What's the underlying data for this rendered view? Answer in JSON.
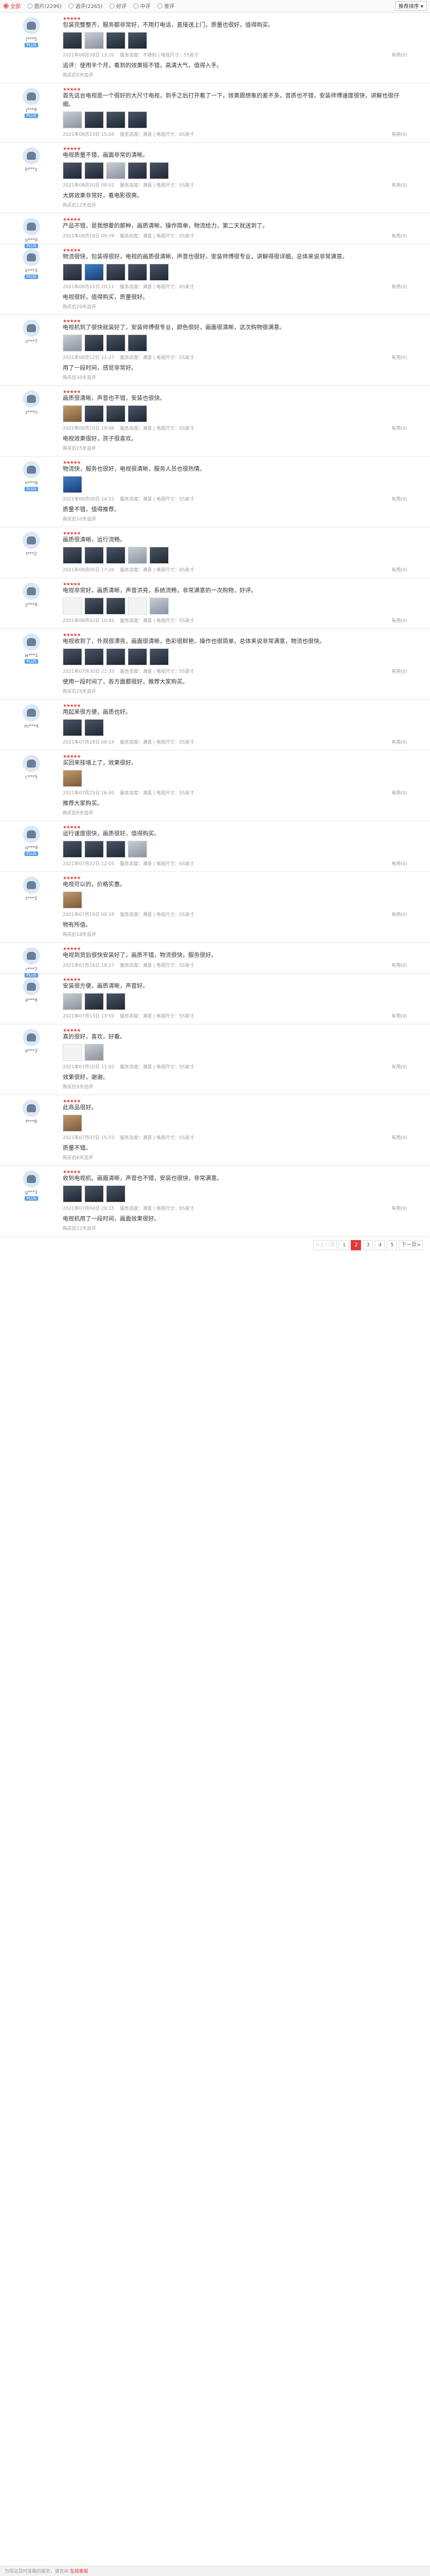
{
  "filter": {
    "options": [
      {
        "label": "全部",
        "on": true
      },
      {
        "label": "图片(2296)",
        "on": false
      },
      {
        "label": "追评(2265)",
        "on": false
      },
      {
        "label": "好评",
        "on": false
      },
      {
        "label": "中评",
        "on": false
      },
      {
        "label": "差评",
        "on": false
      }
    ],
    "sort": "推荐排序 ▾"
  },
  "reviews": [
    {
      "user": "j***5",
      "badge": "PLUS",
      "stars": "★★★★★",
      "text": "包装完整整齐，服务都非常好，不用打电话，直接送上门，质量也很好，值得购买。",
      "photos": [
        "",
        "light",
        "",
        ""
      ],
      "time": "2021年08月28日 13:20",
      "meta": "服务态度：不错的 | 电视尺寸：55英寸",
      "like": "有用(0)",
      "append": "追评：使用半个月，看到的效果挺不错，高清大气，值得入手。",
      "append_time": "购买后5天追评"
    },
    {
      "user": "j***9",
      "badge": "PLUS",
      "stars": "★★★★★",
      "text": "首先这台电视是一个很好的大尺寸电视，到手之后打开看了一下，效果跟想象的差不多，音质也不错，安装师傅速度很快，讲解也很仔细。",
      "photos": [
        "light",
        "",
        "",
        ""
      ],
      "time": "2021年08月23日 15:04",
      "meta": "服务态度：满意 | 电视尺寸：65英寸",
      "like": "有用(0)",
      "append": "",
      "append_time": ""
    },
    {
      "user": "b***y",
      "badge": "",
      "stars": "★★★★★",
      "text": "电视质量不错，画面非常的清晰。",
      "photos": [
        "",
        "",
        "light",
        "",
        ""
      ],
      "time": "2021年08月20日 08:01",
      "meta": "服务态度：满意 | 电视尺寸：55英寸",
      "like": "有用(0)",
      "append": "大屏效果非常好，看电影很爽。",
      "append_time": "购买后12天追评"
    },
    {
      "user": "p***0",
      "badge": "PLUS",
      "stars": "★★★★★",
      "text": "产品不错，是我想要的那种，画质清晰，操作简单，物流给力，第二天就送到了。",
      "photos": [],
      "time": "2021年08月18日 09:39",
      "meta": "服务态度：满意 | 电视尺寸：55英寸",
      "like": "有用(0)",
      "append": "",
      "append_time": ""
    },
    {
      "user": "k***3",
      "badge": "PLUS",
      "stars": "★★★★★",
      "text": "物流很快，包装得很好，电视的画质很清晰，声音也很好，安装师傅很专业，讲解得很详细，总体来说非常满意。",
      "photos": [
        "",
        "blue",
        "",
        "",
        ""
      ],
      "time": "2021年08月15日 20:11",
      "meta": "服务态度：满意 | 电视尺寸：65英寸",
      "like": "有用(0)",
      "append": "电视很好，值得购买，质量很好。",
      "append_time": "购买后20天追评"
    },
    {
      "user": "s***7",
      "badge": "",
      "stars": "★★★★★",
      "text": "电视机到了很快就装好了，安装师傅很专业，颜色很好，画面很清晰，这次购物很满意。",
      "photos": [
        "light",
        "",
        "",
        ""
      ],
      "time": "2021年08月12日 11:27",
      "meta": "服务态度：满意 | 电视尺寸：55英寸",
      "like": "有用(0)",
      "append": "用了一段时间，感觉非常好。",
      "append_time": "购买后30天追评"
    },
    {
      "user": "z***n",
      "badge": "",
      "stars": "★★★★★",
      "text": "画质很清晰，声音也不错，安装也很快。",
      "photos": [
        "wood",
        "",
        "",
        ""
      ],
      "time": "2021年08月10日 19:06",
      "meta": "服务态度：满意 | 电视尺寸：55英寸",
      "like": "有用(0)",
      "append": "电视效果很好，孩子很喜欢。",
      "append_time": "购买后15天追评"
    },
    {
      "user": "h***8",
      "badge": "PLUS",
      "stars": "★★★★★",
      "text": "物流快，服务也很好，电视很清晰，服务人员也很热情。",
      "photos": [
        "blue"
      ],
      "time": "2021年08月08日 14:52",
      "meta": "服务态度：满意 | 电视尺寸：55英寸",
      "like": "有用(0)",
      "append": "质量不错，值得推荐。",
      "append_time": "购买后10天追评"
    },
    {
      "user": "l***2",
      "badge": "",
      "stars": "★★★★★",
      "text": "画质很清晰，运行流畅。",
      "photos": [
        "",
        "",
        "",
        "light",
        ""
      ],
      "time": "2021年08月05日 17:20",
      "meta": "服务态度：满意 | 电视尺寸：65英寸",
      "like": "有用(0)",
      "append": "",
      "append_time": ""
    },
    {
      "user": "y***6",
      "badge": "",
      "stars": "★★★★★",
      "text": "电视非常好，画质清晰，声音洪亮，系统流畅，非常满意的一次购物，好评。",
      "photos": [
        "white",
        "",
        "",
        "white",
        "light"
      ],
      "time": "2021年08月02日 10:45",
      "meta": "服务态度：满意 | 电视尺寸：55英寸",
      "like": "有用(0)",
      "append": "",
      "append_time": ""
    },
    {
      "user": "w***1",
      "badge": "PLUS",
      "stars": "★★★★★",
      "text": "电视收到了，外观很漂亮，画面很清晰，色彩很鲜艳，操作也很简单，总体来说非常满意，物流也很快。",
      "photos": [
        "",
        "",
        "",
        "",
        ""
      ],
      "time": "2021年07月30日 21:33",
      "meta": "服务态度：满意 | 电视尺寸：55英寸",
      "like": "有用(0)",
      "append": "使用一段时间了，各方面都很好，推荐大家购买。",
      "append_time": "购买后25天追评"
    },
    {
      "user": "m***4",
      "badge": "",
      "stars": "★★★★★",
      "text": "用起来很方便，画质也好。",
      "photos": [
        "",
        ""
      ],
      "time": "2021年07月28日 08:14",
      "meta": "服务态度：满意 | 电视尺寸：55英寸",
      "like": "有用(0)",
      "append": "",
      "append_time": ""
    },
    {
      "user": "c***5",
      "badge": "",
      "stars": "★★★★★",
      "text": "买回来挂墙上了，效果很好。",
      "photos": [
        "wood"
      ],
      "time": "2021年07月25日 16:40",
      "meta": "服务态度：满意 | 电视尺寸：55英寸",
      "like": "有用(0)",
      "append": "推荐大家购买。",
      "append_time": "购买后8天追评"
    },
    {
      "user": "q***9",
      "badge": "PLUS",
      "stars": "★★★★★",
      "text": "运行速度很快，画质很好，值得购买。",
      "photos": [
        "",
        "",
        "",
        "light"
      ],
      "time": "2021年07月22日 12:05",
      "meta": "服务态度：满意 | 电视尺寸：65英寸",
      "like": "有用(0)",
      "append": "",
      "append_time": ""
    },
    {
      "user": "t***3",
      "badge": "",
      "stars": "★★★★★",
      "text": "电视可以的，价格实惠。",
      "photos": [
        "wood"
      ],
      "time": "2021年07月19日 09:18",
      "meta": "服务态度：满意 | 电视尺寸：55英寸",
      "like": "有用(0)",
      "append": "物有所值。",
      "append_time": "购买后18天追评"
    },
    {
      "user": "r***7",
      "badge": "PLUS",
      "stars": "★★★★★",
      "text": "电视到货后很快安装好了，画质不错，物流很快，服务很好。",
      "photos": [],
      "time": "2021年07月16日 18:27",
      "meta": "服务态度：满意 | 电视尺寸：55英寸",
      "like": "有用(0)",
      "append": "",
      "append_time": ""
    },
    {
      "user": "a***6",
      "badge": "",
      "stars": "★★★★★",
      "text": "安装很方便，画质清晰，声音好。",
      "photos": [
        "light",
        "",
        ""
      ],
      "time": "2021年07月13日 13:50",
      "meta": "服务态度：满意 | 电视尺寸：55英寸",
      "like": "有用(0)",
      "append": "",
      "append_time": ""
    },
    {
      "user": "e***2",
      "badge": "",
      "stars": "★★★★★",
      "text": "真的很好，喜欢，好看。",
      "photos": [
        "white",
        "light"
      ],
      "time": "2021年07月10日 11:02",
      "meta": "服务态度：满意 | 电视尺寸：55英寸",
      "like": "有用(0)",
      "append": "效果很好，谢谢。",
      "append_time": "购买后9天追评"
    },
    {
      "user": "f***8",
      "badge": "",
      "stars": "★★★★★",
      "text": "此商品很好。",
      "photos": [
        "wood"
      ],
      "time": "2021年07月07日 15:33",
      "meta": "服务态度：满意 | 电视尺寸：55英寸",
      "like": "有用(0)",
      "append": "质量不错。",
      "append_time": "购买后6天追评"
    },
    {
      "user": "g***1",
      "badge": "PLUS",
      "stars": "★★★★★",
      "text": "收到电视机，画面清晰，声音也不错，安装也很快，非常满意。",
      "photos": [
        "",
        "",
        ""
      ],
      "time": "2021年07月04日 20:15",
      "meta": "服务态度：满意 | 电视尺寸：65英寸",
      "like": "有用(0)",
      "append": "电视机用了一段时间，画面效果很好。",
      "append_time": "购买后22天追评"
    }
  ],
  "pager": {
    "prev": "<上一页",
    "pages": [
      "1",
      "2",
      "3",
      "4",
      "5"
    ],
    "next": "下一页>"
  },
  "footer": {
    "text": "为保证及时准确的服务，请咨询",
    "link": "在线客服"
  },
  "colors": {
    "accent": "#e4393c"
  }
}
